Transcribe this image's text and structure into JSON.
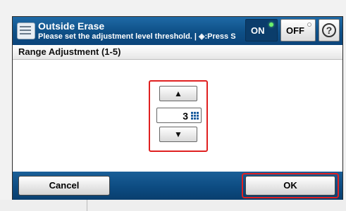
{
  "header": {
    "title": "Outside Erase",
    "subtitle": "Please set the adjustment level threshold. | ◈:Press S",
    "toggle_on_label": "ON",
    "toggle_off_label": "OFF",
    "help_label": "?"
  },
  "section": {
    "label": "Range Adjustment (1-5)"
  },
  "stepper": {
    "up_symbol": "▲",
    "down_symbol": "▼",
    "value": "3"
  },
  "footer": {
    "cancel_label": "Cancel",
    "ok_label": "OK"
  },
  "colors": {
    "title_bar": "#0e4f86",
    "highlight": "#e02020",
    "led_on": "#6cf06c"
  },
  "icons": {
    "app": "outside-erase-icon",
    "help": "help-icon",
    "keypad": "keypad-icon"
  }
}
